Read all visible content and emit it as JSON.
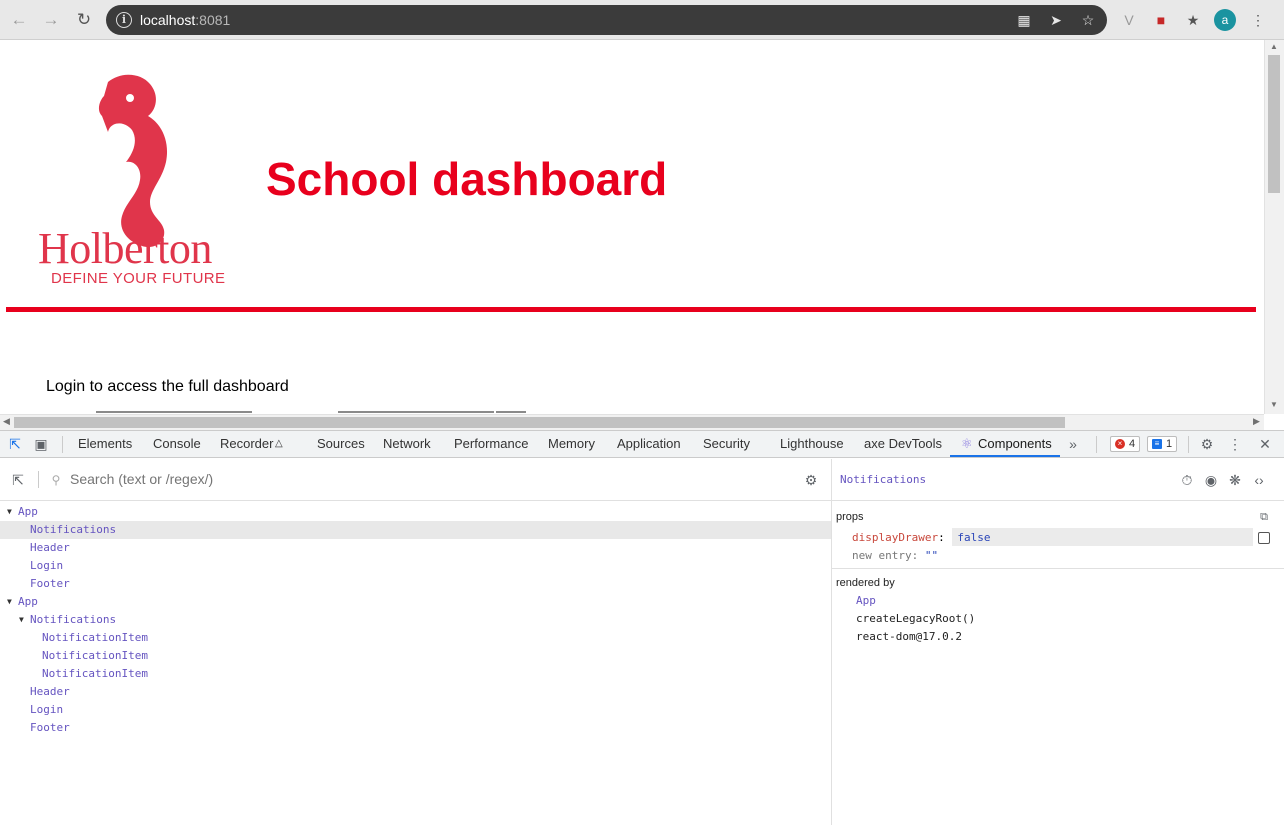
{
  "browser": {
    "url_host": "localhost",
    "url_port": ":8081",
    "avatar_letter": "a"
  },
  "page": {
    "logo_word": "Holberton",
    "logo_tagline": "DEFINE YOUR FUTURE",
    "title": "School dashboard",
    "login_prompt": "Login to access the full dashboard"
  },
  "devtools": {
    "tabs": [
      "Elements",
      "Console",
      "Recorder",
      "Sources",
      "Network",
      "Performance",
      "Memory",
      "Application",
      "Security",
      "Lighthouse",
      "axe DevTools",
      "Components"
    ],
    "active_tab": "Components",
    "errors_count": "4",
    "messages_count": "1",
    "search_placeholder": "Search (text or /regex/)",
    "tree": [
      {
        "label": "App",
        "depth": 0,
        "expanded": true
      },
      {
        "label": "Notifications",
        "depth": 1,
        "selected": true
      },
      {
        "label": "Header",
        "depth": 1
      },
      {
        "label": "Login",
        "depth": 1
      },
      {
        "label": "Footer",
        "depth": 1
      },
      {
        "label": "App",
        "depth": 0,
        "expanded": true
      },
      {
        "label": "Notifications",
        "depth": 1,
        "expanded": true
      },
      {
        "label": "NotificationItem",
        "depth": 2
      },
      {
        "label": "NotificationItem",
        "depth": 2
      },
      {
        "label": "NotificationItem",
        "depth": 2
      },
      {
        "label": "Header",
        "depth": 1
      },
      {
        "label": "Login",
        "depth": 1
      },
      {
        "label": "Footer",
        "depth": 1
      }
    ],
    "selected_component": "Notifications",
    "props_label": "props",
    "props": [
      {
        "key": "displayDrawer",
        "value": "false"
      },
      {
        "key": "new entry",
        "value": "\"\""
      }
    ],
    "rendered_by_label": "rendered by",
    "rendered_by": [
      "App",
      "createLegacyRoot()",
      "react-dom@17.0.2"
    ]
  },
  "colors": {
    "brand_red": "#e8001d",
    "logo_red": "#e0354b",
    "component_purple": "#6554c0"
  }
}
